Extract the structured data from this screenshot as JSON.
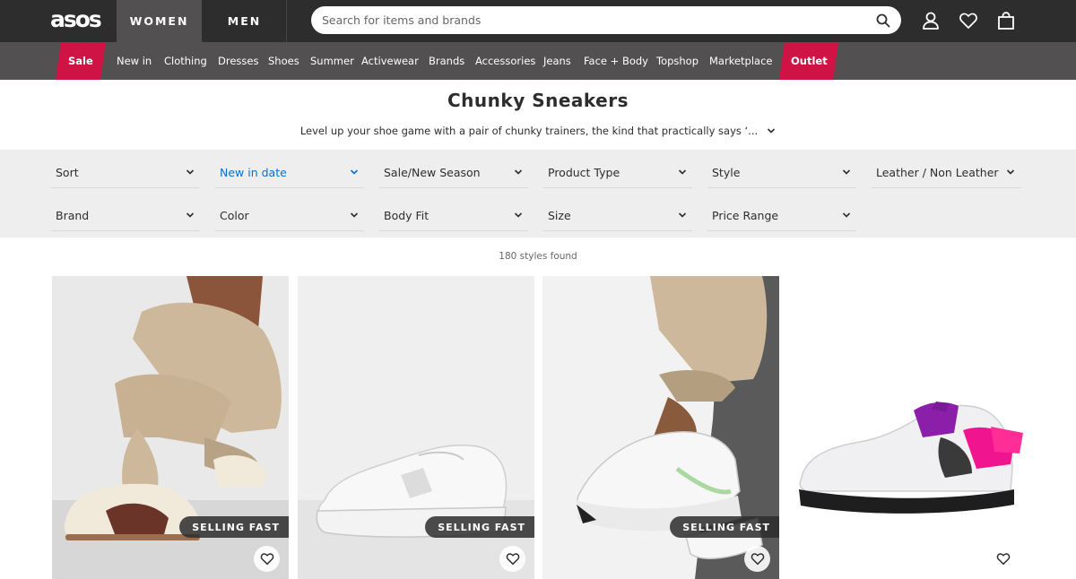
{
  "header": {
    "logo": "asos",
    "tabs": [
      {
        "label": "WOMEN"
      },
      {
        "label": "MEN"
      }
    ],
    "search": {
      "placeholder": "Search for items and brands"
    },
    "icons": [
      "search-icon",
      "account-icon",
      "saved-items-icon",
      "bag-icon"
    ]
  },
  "nav": {
    "items": [
      {
        "label": "Sale"
      },
      {
        "label": "New in"
      },
      {
        "label": "Clothing"
      },
      {
        "label": "Dresses"
      },
      {
        "label": "Shoes"
      },
      {
        "label": "Summer"
      },
      {
        "label": "Activewear"
      },
      {
        "label": "Brands"
      },
      {
        "label": "Accessories"
      },
      {
        "label": "Jeans"
      },
      {
        "label": "Face + Body"
      },
      {
        "label": "Topshop"
      },
      {
        "label": "Marketplace"
      },
      {
        "label": "Outlet"
      }
    ]
  },
  "page": {
    "title": "Chunky Sneakers",
    "intro": "Level up your shoe game with a pair of chunky trainers, the kind that practically says ‘..."
  },
  "filters": [
    {
      "label": "Sort"
    },
    {
      "label": "New in date"
    },
    {
      "label": "Sale/New Season"
    },
    {
      "label": "Product Type"
    },
    {
      "label": "Style"
    },
    {
      "label": "Leather / Non Leather"
    },
    {
      "label": "Brand"
    },
    {
      "label": "Color"
    },
    {
      "label": "Body Fit"
    },
    {
      "label": "Size"
    },
    {
      "label": "Price Range"
    }
  ],
  "results": {
    "count_text": "180 styles found"
  },
  "products": [
    {
      "badge": "SELLING FAST"
    },
    {
      "badge": "SELLING FAST"
    },
    {
      "badge": "SELLING FAST"
    },
    {
      "badge": ""
    }
  ],
  "colors": {
    "topbar": "#2d2d2d",
    "navbar": "#525050",
    "sale_red": "#d01345",
    "filter_bg": "#eeeeee",
    "active_blue": "#0770cf"
  }
}
